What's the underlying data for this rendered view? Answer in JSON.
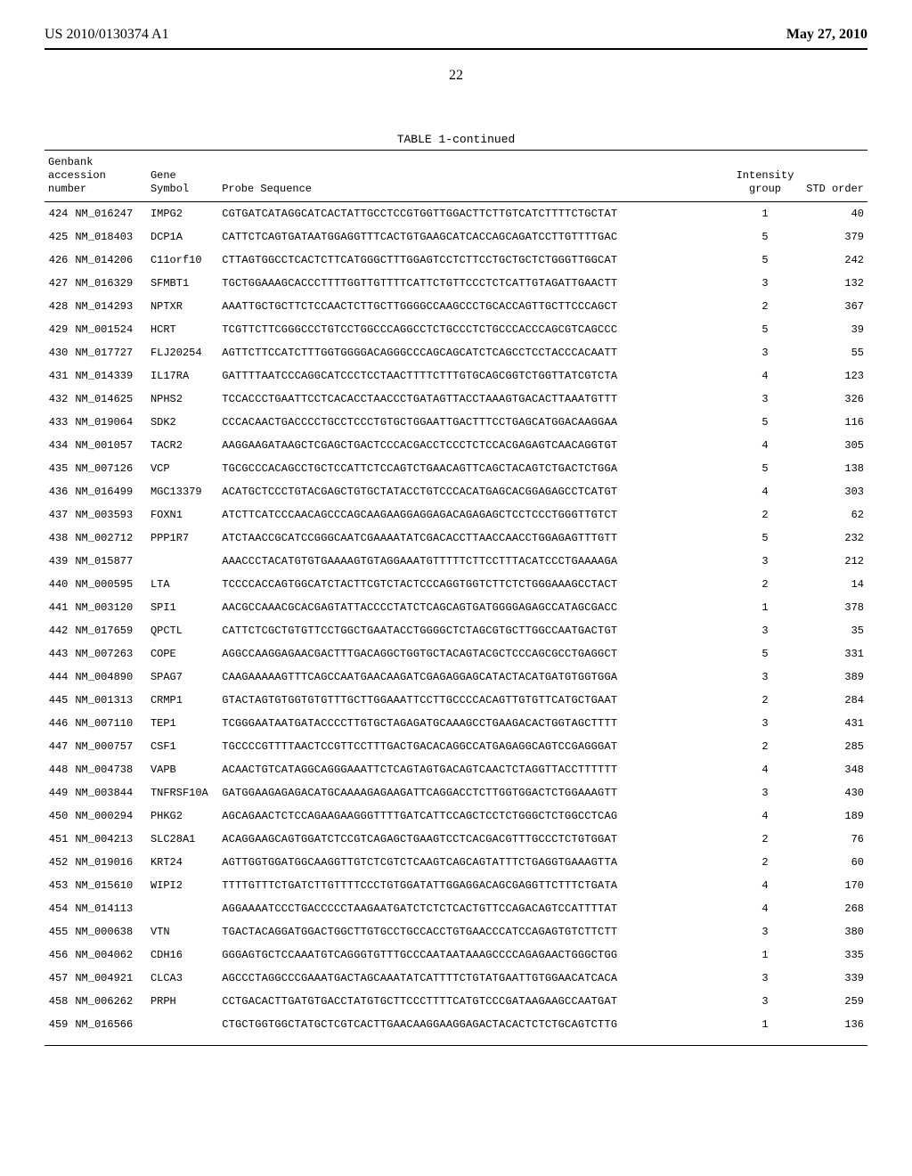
{
  "header": {
    "left": "US 2010/0130374 A1",
    "right": "May 27, 2010"
  },
  "page_number": "22",
  "table": {
    "caption": "TABLE 1-continued",
    "columns": {
      "accession": {
        "l1": "Genbank",
        "l2": "accession",
        "l3": "number"
      },
      "gene": {
        "l1": "Gene",
        "l2": "Symbol"
      },
      "probe": {
        "label": "Probe Sequence"
      },
      "intensity": {
        "l1": "Intensity",
        "l2": "group"
      },
      "std": {
        "label": "STD order"
      }
    },
    "rows": [
      {
        "idx": "424",
        "acc": "NM_016247",
        "sym": "IMPG2",
        "seq": "CGTGATCATAGGCATCACTATTGCCTCCGTGGTTGGACTTCTTGTCATCTTTTCTGCTAT",
        "grp": "1",
        "ord": "40"
      },
      {
        "idx": "425",
        "acc": "NM_018403",
        "sym": "DCP1A",
        "seq": "CATTCTCAGTGATAATGGAGGTTTCACTGTGAAGCATCACCAGCAGATCCTTGTTTTGAC",
        "grp": "5",
        "ord": "379"
      },
      {
        "idx": "426",
        "acc": "NM_014206",
        "sym": "C11orf10",
        "seq": "CTTAGTGGCCTCACTCTTCATGGGCTTTGGAGTCCTCTTCCTGCTGCTCTGGGTTGGCAT",
        "grp": "5",
        "ord": "242"
      },
      {
        "idx": "427",
        "acc": "NM_016329",
        "sym": "SFMBT1",
        "seq": "TGCTGGAAAGCACCCTTTTGGTTGTTTTCATTCTGTTCCCTCTCATTGTAGATTGAACTT",
        "grp": "3",
        "ord": "132"
      },
      {
        "idx": "428",
        "acc": "NM_014293",
        "sym": "NPTXR",
        "seq": "AAATTGCTGCTTCTCCAACTCTTGCTTGGGGCCAAGCCCTGCACCAGTTGCTTCCCAGCT",
        "grp": "2",
        "ord": "367"
      },
      {
        "idx": "429",
        "acc": "NM_001524",
        "sym": "HCRT",
        "seq": "TCGTTCTTCGGGCCCTGTCCTGGCCCAGGCCTCTGCCCTCTGCCCACCCAGCGTCAGCCC",
        "grp": "5",
        "ord": "39"
      },
      {
        "idx": "430",
        "acc": "NM_017727",
        "sym": "FLJ20254",
        "seq": "AGTTCTTCCATCTTTGGTGGGGACAGGGCCCAGCAGCATCTCAGCCTCCTACCCACAATT",
        "grp": "3",
        "ord": "55"
      },
      {
        "idx": "431",
        "acc": "NM_014339",
        "sym": "IL17RA",
        "seq": "GATTTTAATCCCAGGCATCCCTCCTAACTTTTCTTTGTGCAGCGGTCTGGTTATCGTCTA",
        "grp": "4",
        "ord": "123"
      },
      {
        "idx": "432",
        "acc": "NM_014625",
        "sym": "NPHS2",
        "seq": "TCCACCCTGAATTCCTCACACCTAACCCTGATAGTTACCTAAAGTGACACTTAAATGTTT",
        "grp": "3",
        "ord": "326"
      },
      {
        "idx": "433",
        "acc": "NM_019064",
        "sym": "SDK2",
        "seq": "CCCACAACTGACCCCTGCCTCCCTGTGCTGGAATTGACTTTCCTGAGCATGGACAAGGAA",
        "grp": "5",
        "ord": "116"
      },
      {
        "idx": "434",
        "acc": "NM_001057",
        "sym": "TACR2",
        "seq": "AAGGAAGATAAGCTCGAGCTGACTCCCACGACCTCCCTCTCCACGAGAGTCAACAGGTGT",
        "grp": "4",
        "ord": "305"
      },
      {
        "idx": "435",
        "acc": "NM_007126",
        "sym": "VCP",
        "seq": "TGCGCCCACAGCCTGCTCCATTCTCCAGTCTGAACAGTTCAGCTACAGTCTGACTCTGGA",
        "grp": "5",
        "ord": "138"
      },
      {
        "idx": "436",
        "acc": "NM_016499",
        "sym": "MGC13379",
        "seq": "ACATGCTCCCTGTACGAGCTGTGCTATACCTGTCCCACATGAGCACGGAGAGCCTCATGT",
        "grp": "4",
        "ord": "303"
      },
      {
        "idx": "437",
        "acc": "NM_003593",
        "sym": "FOXN1",
        "seq": "ATCTTCATCCCAACAGCCCAGCAAGAAGGAGGAGACAGAGAGCTCCTCCCTGGGTTGTCT",
        "grp": "2",
        "ord": "62"
      },
      {
        "idx": "438",
        "acc": "NM_002712",
        "sym": "PPP1R7",
        "seq": "ATCTAACCGCATCCGGGCAATCGAAAATATCGACACCTTAACCAACCTGGAGAGTTTGTT",
        "grp": "5",
        "ord": "232"
      },
      {
        "idx": "439",
        "acc": "NM_015877",
        "sym": "",
        "seq": "AAACCCTACATGTGTGAAAAGTGTAGGAAATGTTTTTCTTCCTTTACATCCCTGAAAAGA",
        "grp": "3",
        "ord": "212"
      },
      {
        "idx": "440",
        "acc": "NM_000595",
        "sym": "LTA",
        "seq": "TCCCCACCAGTGGCATCTACTTCGTCTACTCCCAGGTGGTCTTCTCTGGGAAAGCCTACT",
        "grp": "2",
        "ord": "14"
      },
      {
        "idx": "441",
        "acc": "NM_003120",
        "sym": "SPI1",
        "seq": "AACGCCAAACGCACGAGTATTACCCCTATCTCAGCAGTGATGGGGAGAGCCATAGCGACC",
        "grp": "1",
        "ord": "378"
      },
      {
        "idx": "442",
        "acc": "NM_017659",
        "sym": "QPCTL",
        "seq": "CATTCTCGCTGTGTTCCTGGCTGAATACCTGGGGCTCTAGCGTGCTTGGCCAATGACTGT",
        "grp": "3",
        "ord": "35"
      },
      {
        "idx": "443",
        "acc": "NM_007263",
        "sym": "COPE",
        "seq": "AGGCCAAGGAGAACGACTTTGACAGGCTGGTGCTACAGTACGCTCCCAGCGCCTGAGGCT",
        "grp": "5",
        "ord": "331"
      },
      {
        "idx": "444",
        "acc": "NM_004890",
        "sym": "SPAG7",
        "seq": "CAAGAAAAAGTTTCAGCCAATGAACAAGATCGAGAGGAGCATACTACATGATGTGGTGGA",
        "grp": "3",
        "ord": "389"
      },
      {
        "idx": "445",
        "acc": "NM_001313",
        "sym": "CRMP1",
        "seq": "GTACTAGTGTGGTGTGTTTGCTTGGAAATTCCTTGCCCCACAGTTGTGTTCATGCTGAAT",
        "grp": "2",
        "ord": "284"
      },
      {
        "idx": "446",
        "acc": "NM_007110",
        "sym": "TEP1",
        "seq": "TCGGGAATAATGATACCCCTTGTGCTAGAGATGCAAAGCCTGAAGACACTGGTAGCTTTT",
        "grp": "3",
        "ord": "431"
      },
      {
        "idx": "447",
        "acc": "NM_000757",
        "sym": "CSF1",
        "seq": "TGCCCCGTTTTAACTCCGTTCCTTTGACTGACACAGGCCATGAGAGGCAGTCCGAGGGAT",
        "grp": "2",
        "ord": "285"
      },
      {
        "idx": "448",
        "acc": "NM_004738",
        "sym": "VAPB",
        "seq": "ACAACTGTCATAGGCAGGGAAATTCTCAGTAGTGACAGTCAACTCTAGGTTACCTTTTTT",
        "grp": "4",
        "ord": "348"
      },
      {
        "idx": "449",
        "acc": "NM_003844",
        "sym": "TNFRSF10A",
        "seq": "GATGGAAGAGAGACATGCAAAAGAGAAGATTCAGGACCTCTTGGTGGACTCTGGAAAGTT",
        "grp": "3",
        "ord": "430"
      },
      {
        "idx": "450",
        "acc": "NM_000294",
        "sym": "PHKG2",
        "seq": "AGCAGAACTCTCCAGAAGAAGGGTTTTGATCATTCCAGCTCCTCTGGGCTCTGGCCTCAG",
        "grp": "4",
        "ord": "189"
      },
      {
        "idx": "451",
        "acc": "NM_004213",
        "sym": "SLC28A1",
        "seq": "ACAGGAAGCAGTGGATCTCCGTCAGAGCTGAAGTCCTCACGACGTTTGCCCTCTGTGGAT",
        "grp": "2",
        "ord": "76"
      },
      {
        "idx": "452",
        "acc": "NM_019016",
        "sym": "KRT24",
        "seq": "AGTTGGTGGATGGCAAGGTTGTCTCGTCTCAAGTCAGCAGTATTTCTGAGGTGAAAGTTA",
        "grp": "2",
        "ord": "60"
      },
      {
        "idx": "453",
        "acc": "NM_015610",
        "sym": "WIPI2",
        "seq": "TTTTGTTTCTGATCTTGTTTTCCCTGTGGATATTGGAGGACAGCGAGGTTCTTTCTGATA",
        "grp": "4",
        "ord": "170"
      },
      {
        "idx": "454",
        "acc": "NM_014113",
        "sym": "",
        "seq": "AGGAAAATCCCTGACCCCCTAAGAATGATCTCTCTCACTGTTCCAGACAGTCCATTTTAT",
        "grp": "4",
        "ord": "268"
      },
      {
        "idx": "455",
        "acc": "NM_000638",
        "sym": "VTN",
        "seq": "TGACTACAGGATGGACTGGCTTGTGCCTGCCACCTGTGAACCCATCCAGAGTGTCTTCTT",
        "grp": "3",
        "ord": "380"
      },
      {
        "idx": "456",
        "acc": "NM_004062",
        "sym": "CDH16",
        "seq": "GGGAGTGCTCCAAATGTCAGGGTGTTTGCCCAATAATAAAGCCCCAGAGAACTGGGCTGG",
        "grp": "1",
        "ord": "335"
      },
      {
        "idx": "457",
        "acc": "NM_004921",
        "sym": "CLCA3",
        "seq": "AGCCCTAGGCCCGAAATGACTAGCAAATATCATTTTCTGTATGAATTGTGGAACATCACA",
        "grp": "3",
        "ord": "339"
      },
      {
        "idx": "458",
        "acc": "NM_006262",
        "sym": "PRPH",
        "seq": "CCTGACACTTGATGTGACCTATGTGCTTCCCTTTTCATGTCCCGATAAGAAGCCAATGAT",
        "grp": "3",
        "ord": "259"
      },
      {
        "idx": "459",
        "acc": "NM_016566",
        "sym": "",
        "seq": "CTGCTGGTGGCTATGCTCGTCACTTGAACAAGGAAGGAGACTACACTCTCTGCAGTCTTG",
        "grp": "1",
        "ord": "136"
      }
    ]
  }
}
